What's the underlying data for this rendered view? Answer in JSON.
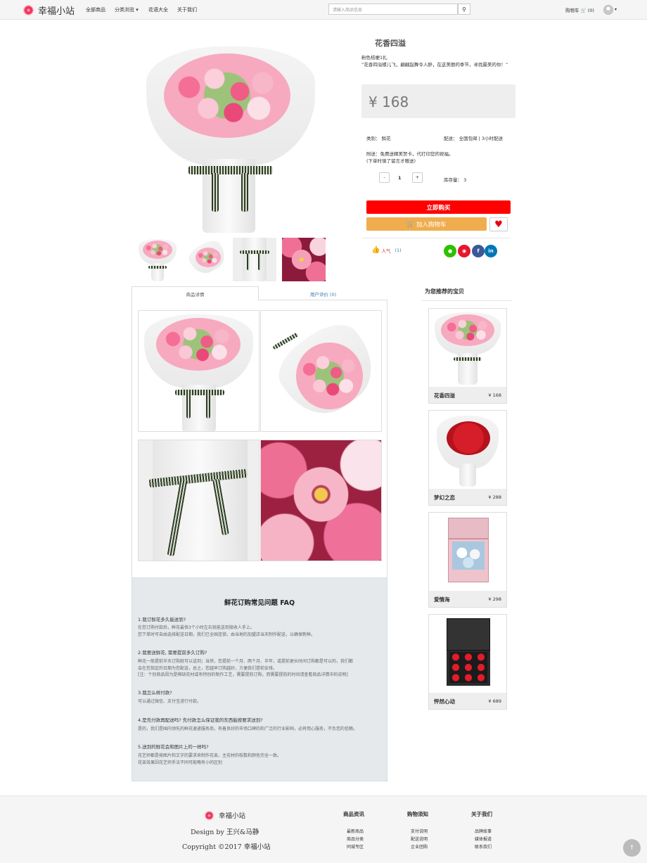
{
  "brand": {
    "name": "幸福小站"
  },
  "nav": {
    "all": "全部商品",
    "category": "分类浏览 ▾",
    "flowers": "花语大全",
    "about": "关于我们"
  },
  "search": {
    "placeholder": "请输入商品信息",
    "icon": "search-icon"
  },
  "cart": {
    "label": "购物车",
    "count": "(0)"
  },
  "product": {
    "title": "花香四溢",
    "subtitle": "粉色桔梗1扎",
    "description": "“花香四溢蝶儿飞，翩翩起舞令人醉，在这美丽的季节，寻找最美的你！”",
    "price": "¥ 168",
    "category": "类别：  鲜花",
    "delivery": "配送：  全国包邮 | 3小时配送",
    "extra_line1": "附送：免费送精美贺卡，代打印您的祝福。",
    "extra_line2": "(下单时填了留言才赠送)",
    "qty_minus": "-",
    "qty": "1",
    "qty_plus": "+",
    "stock": "库存量：  3",
    "buy_label": "立即购买",
    "cart_label": "加入购物车",
    "popular_label": "人气",
    "popular_count": "(1)"
  },
  "tabs": {
    "detail": "商品详情",
    "reviews": "用户评价 (0)"
  },
  "faq": {
    "title": "鲜花订购常见问题 FAQ",
    "items": [
      {
        "q": "1.我订鲜花多久能送到?",
        "a": [
          "在您订购付款后，鲜花最快3个小时左右就能送到接收人手上。",
          "您下单时可自由选择配送日期，我们已全国连锁，由当地的加盟店当天制作配送，以确保新鲜。"
        ]
      },
      {
        "q": "2.我要送鲜花, 需要提前多久订购?",
        "a": [
          "鲜花一般提前半天订购就可以送到；当然，您提前一个月、两个月、半年，或提前更长时间订购都是可以的，我们都",
          "会在您指定的日期为您配送，总之，您越早订购越好，方便我们提前安排。",
          "[注：个别商品因为是稀缺花材或有特别的制作工艺，需要提前订购，而需要提前的时间请查看商品详情中的说明]"
        ]
      },
      {
        "q": "3.我怎么样付款?",
        "a": [
          "可以通过微信、支付宝进行付款。"
        ]
      },
      {
        "q": "4.是先付款再配送吗? 先付款怎么保证我的东西能按要求送到?",
        "a": [
          "是的，我们是国内领先的鲜花速递服务商，有着良好的市场口碑的和广泛的行业影响，必将用心服务，不负您的信赖。"
        ]
      },
      {
        "q": "5.送到的鲜花会和图片上的一样吗?",
        "a": [
          "花艺师都是按图片和文字的要求来制作花束，主花材的枝数和颜色完全一致。",
          "花束效果因花艺师手法不同可能略有小的区别"
        ]
      }
    ]
  },
  "recommend": {
    "title": "为您推荐的宝贝",
    "items": [
      {
        "name": "花香四溢",
        "price": "¥ 168"
      },
      {
        "name": "梦幻之恋",
        "price": "¥ 288"
      },
      {
        "name": "爱情海",
        "price": "¥ 298"
      },
      {
        "name": "怦然心动",
        "price": "¥ 689"
      }
    ]
  },
  "footer": {
    "brand": "幸福小站",
    "design": "Design by 王兴&马静",
    "copyright": "Copyright ©2017 幸福小站",
    "cols": [
      {
        "title": "商品资讯",
        "links": [
          "最新商品",
          "商品分类",
          "同城专区"
        ]
      },
      {
        "title": "购物须知",
        "links": [
          "支付说明",
          "配送说明",
          "企业团购"
        ]
      },
      {
        "title": "关于我们",
        "links": [
          "品牌故事",
          "媒体报道",
          "联系我们"
        ]
      }
    ]
  },
  "colors": {
    "buy": "#ff0000",
    "cart": "#f0ad4e",
    "faq_bg": "#e5e9ec"
  }
}
